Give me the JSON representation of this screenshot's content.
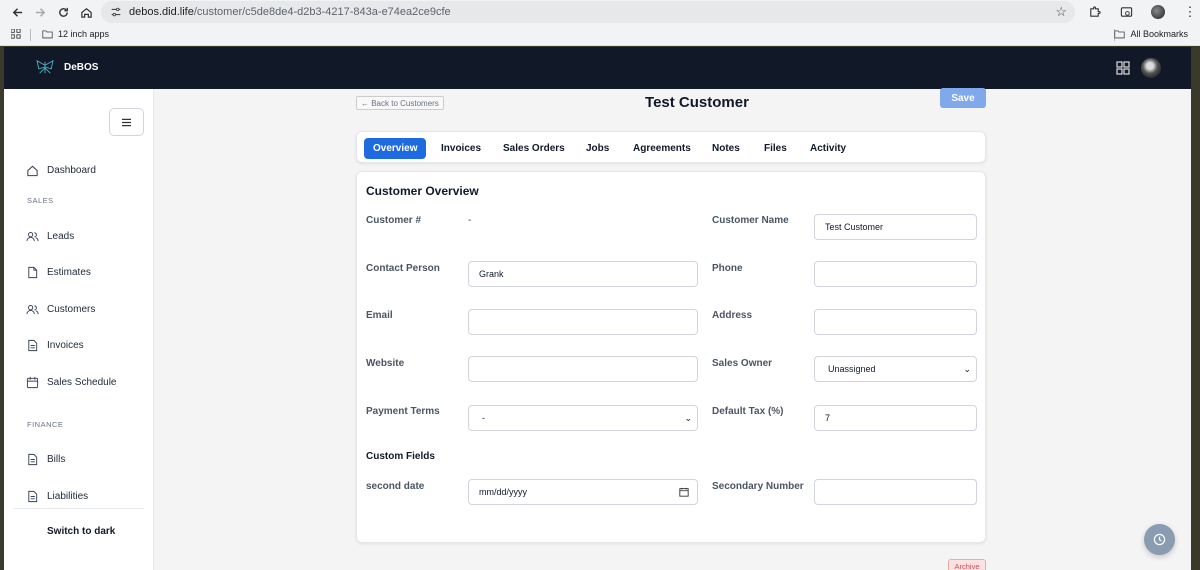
{
  "browser": {
    "url_host": "debos.did.life",
    "url_path": "/customer/c5de8de4-d2b3-4217-843a-e74ea2ce9cfe",
    "bookmark_folder": "12 inch apps",
    "all_bookmarks": "All Bookmarks"
  },
  "app": {
    "brand": "DeBOS"
  },
  "sidebar": {
    "dashboard": "Dashboard",
    "sales_section": "SALES",
    "leads": "Leads",
    "estimates": "Estimates",
    "customers": "Customers",
    "invoices": "Invoices",
    "sales_schedule": "Sales Schedule",
    "finance_section": "FINANCE",
    "bills": "Bills",
    "liabilities": "Liabilities",
    "switch_theme": "Switch to dark"
  },
  "header": {
    "back_label": "← Back to Customers",
    "title": "Test Customer",
    "save_label": "Save"
  },
  "tabs": [
    "Overview",
    "Invoices",
    "Sales Orders",
    "Jobs",
    "Agreements",
    "Notes",
    "Files",
    "Activity"
  ],
  "overview": {
    "title": "Customer Overview",
    "customer_number_label": "Customer #",
    "customer_number_value": "-",
    "customer_name_label": "Customer Name",
    "customer_name_value": "Test Customer",
    "contact_person_label": "Contact Person",
    "contact_person_value": "Grank",
    "phone_label": "Phone",
    "phone_value": "",
    "email_label": "Email",
    "email_value": "",
    "address_label": "Address",
    "address_value": "",
    "website_label": "Website",
    "website_value": "",
    "sales_owner_label": "Sales Owner",
    "sales_owner_value": "Unassigned",
    "payment_terms_label": "Payment Terms",
    "payment_terms_value": "-",
    "default_tax_label": "Default Tax (%)",
    "default_tax_value": "7",
    "custom_fields_title": "Custom Fields",
    "second_date_label": "second date",
    "second_date_placeholder": "mm/dd/yyyy",
    "secondary_number_label": "Secondary Number",
    "secondary_number_value": ""
  },
  "footer": {
    "archive_label": "Archive"
  },
  "colors": {
    "topnav": "#111827",
    "accent": "#1d6bdf",
    "save_button": "#7fa9ea"
  }
}
